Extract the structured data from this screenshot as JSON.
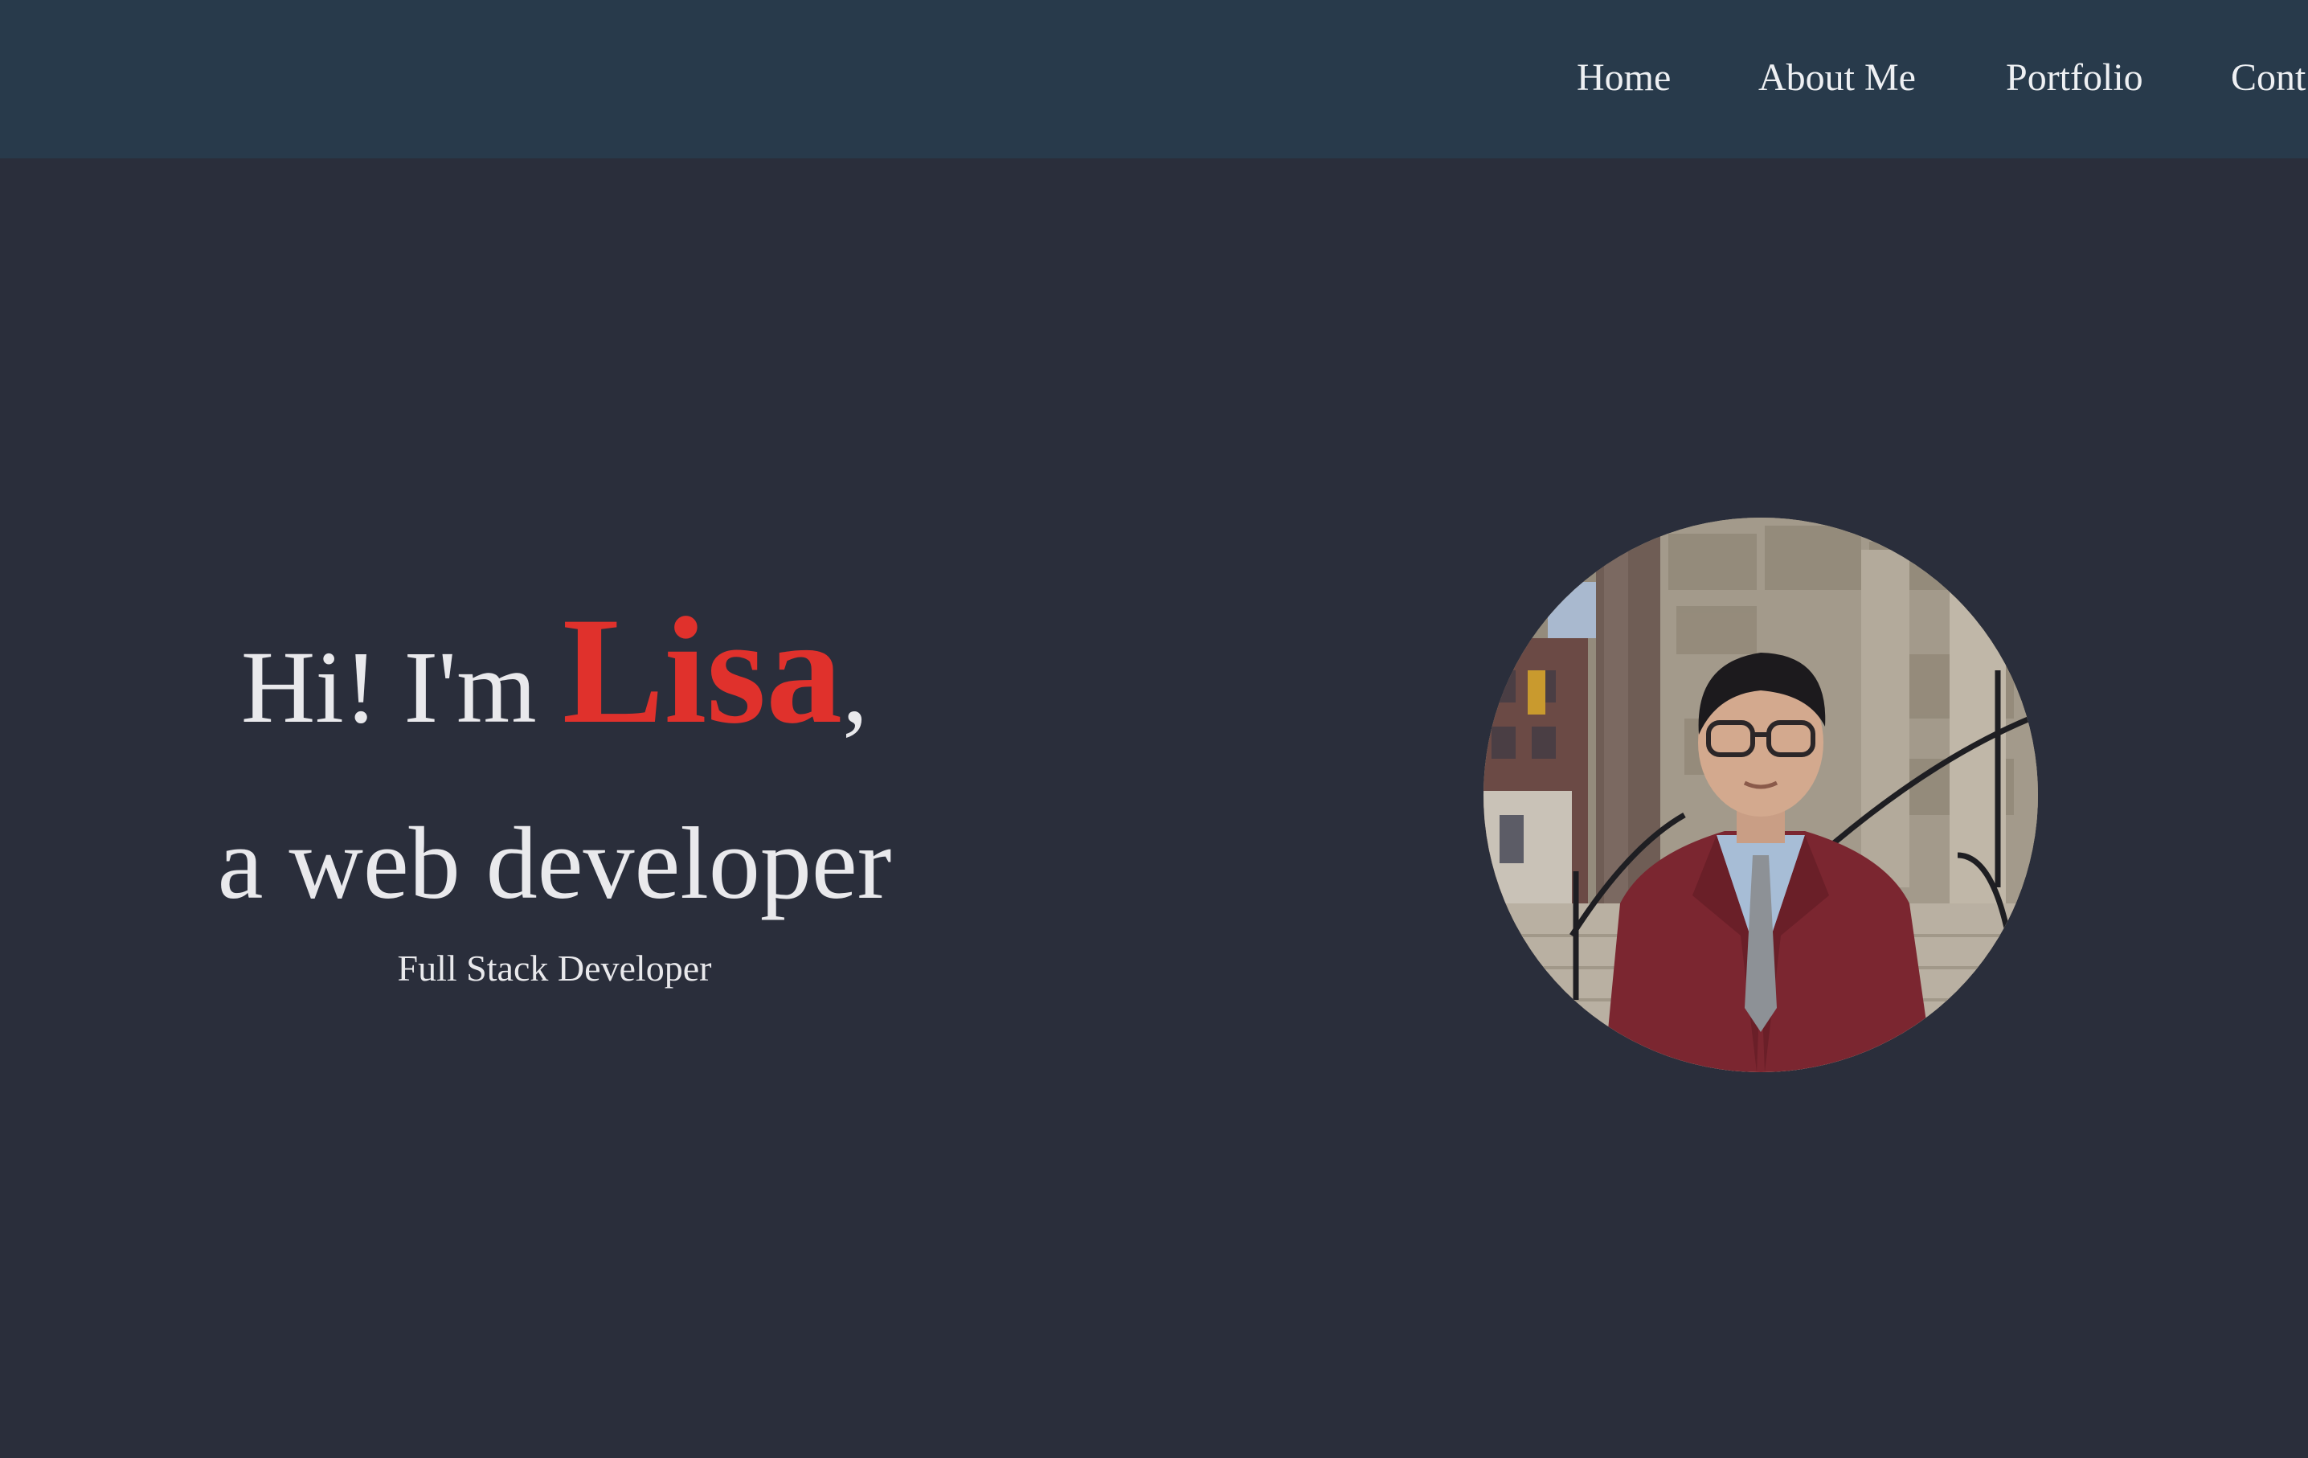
{
  "nav": {
    "items": [
      {
        "label": "Home"
      },
      {
        "label": "About Me"
      },
      {
        "label": "Portfolio"
      },
      {
        "label": "Cont"
      }
    ]
  },
  "hero": {
    "greeting_prefix": "Hi! I'm ",
    "name": "Lisa",
    "greeting_suffix": ",",
    "subtitle": "a web developer",
    "tagline": "Full Stack Developer"
  },
  "colors": {
    "navbar_bg": "#283a4b",
    "page_bg": "#2a2e3b",
    "accent": "#e0312c",
    "text": "#e9e9ec"
  }
}
